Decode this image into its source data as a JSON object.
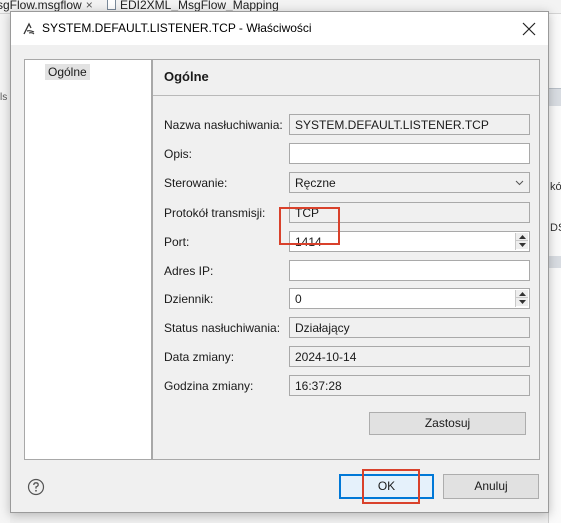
{
  "background": {
    "tab1_label": "sgFlow.msgflow",
    "tab1_close": "×",
    "tab2_label": "EDI2XML_MsgFlow_Mapping",
    "right_text1": "kół",
    "right_text2": "DS",
    "left_text": "ls"
  },
  "dialog": {
    "title": "SYSTEM.DEFAULT.LISTENER.TCP - Właściwości",
    "nav_items": [
      "Ogólne"
    ],
    "panel_title": "Ogólne",
    "fields": {
      "listener_name": {
        "label": "Nazwa nasłuchiwania:",
        "value": "SYSTEM.DEFAULT.LISTENER.TCP"
      },
      "description": {
        "label": "Opis:",
        "value": ""
      },
      "control": {
        "label": "Sterowanie:",
        "value": "Ręczne"
      },
      "protocol": {
        "label": "Protokół transmisji:",
        "value": "TCP"
      },
      "port": {
        "label": "Port:",
        "value": "1414"
      },
      "ip_address": {
        "label": "Adres IP:",
        "value": ""
      },
      "log": {
        "label": "Dziennik:",
        "value": "0"
      },
      "status": {
        "label": "Status nasłuchiwania:",
        "value": "Działający"
      },
      "change_date": {
        "label": "Data zmiany:",
        "value": "2024-10-14"
      },
      "change_time": {
        "label": "Godzina zmiany:",
        "value": "16:37:28"
      }
    },
    "apply_label": "Zastosuj",
    "ok_label": "OK",
    "cancel_label": "Anuluj",
    "highlight_color": "#d9412b",
    "accent_color": "#0078d7"
  }
}
